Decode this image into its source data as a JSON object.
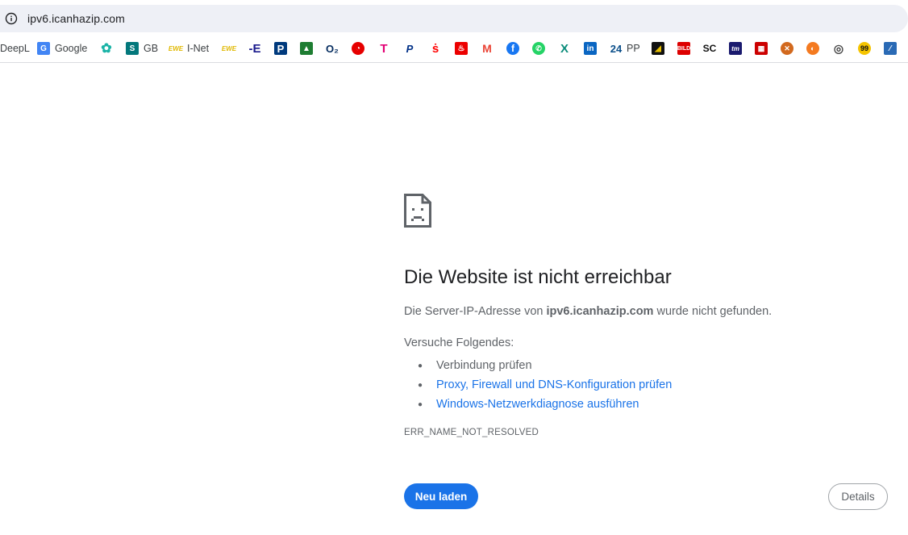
{
  "omnibox": {
    "url": "ipv6.icanhazip.com",
    "info_icon": "info-icon"
  },
  "bookmarks": [
    {
      "label": "DeepL",
      "icon": "deepl-icon",
      "color": "#0f2b46"
    },
    {
      "label": "Google",
      "icon": "google-translate-icon",
      "color": "#4285f4"
    },
    {
      "label": "",
      "icon": "flower-icon",
      "color": "#1ab3a6"
    },
    {
      "label": "GB",
      "icon": "sharepoint-icon",
      "color": "#03787c"
    },
    {
      "label": "I-Net",
      "icon": "ewe-icon",
      "color": "#f5d000"
    },
    {
      "label": "",
      "icon": "ewe-icon",
      "color": "#f5d000"
    },
    {
      "label": "",
      "icon": "e-icon",
      "color": "#1a1a8c"
    },
    {
      "label": "",
      "icon": "parking-icon",
      "color": "#003a7d"
    },
    {
      "label": "",
      "icon": "green-app-icon",
      "color": "#1e7d32"
    },
    {
      "label": "",
      "icon": "o2-icon",
      "color": "#032b5e"
    },
    {
      "label": "",
      "icon": "vodafone-icon",
      "color": "#e60000"
    },
    {
      "label": "",
      "icon": "telekom-icon",
      "color": "#e20074"
    },
    {
      "label": "",
      "icon": "paypal-icon",
      "color": "#003087"
    },
    {
      "label": "",
      "icon": "sparkasse-icon",
      "color": "#ff0000"
    },
    {
      "label": "",
      "icon": "santander-icon",
      "color": "#ec0000"
    },
    {
      "label": "",
      "icon": "gmail-icon",
      "color": "#ea4335"
    },
    {
      "label": "",
      "icon": "facebook-icon",
      "color": "#1877f2"
    },
    {
      "label": "",
      "icon": "whatsapp-icon",
      "color": "#25d366"
    },
    {
      "label": "",
      "icon": "xing-icon",
      "color": "#0a8c7a"
    },
    {
      "label": "",
      "icon": "linkedin-icon",
      "color": "#0a66c2"
    },
    {
      "label": "PP",
      "icon": "24-icon",
      "color": "#0b4f8a"
    },
    {
      "label": "",
      "icon": "yellow-app-icon",
      "color": "#e8c000"
    },
    {
      "label": "",
      "icon": "bild-icon",
      "color": "#dd0000"
    },
    {
      "label": "",
      "icon": "sc-icon",
      "color": "#111111"
    },
    {
      "label": "",
      "icon": "tm-icon",
      "color": "#1a1a6e"
    },
    {
      "label": "",
      "icon": "red-grid-icon",
      "color": "#cc0000"
    },
    {
      "label": "",
      "icon": "basketball-icon",
      "color": "#d2691e"
    },
    {
      "label": "",
      "icon": "orange-ball-icon",
      "color": "#f47a20"
    },
    {
      "label": "",
      "icon": "globe-icon",
      "color": "#444444"
    },
    {
      "label": "",
      "icon": "99-icon",
      "color": "#f5c400"
    },
    {
      "label": "",
      "icon": "blue-app-icon",
      "color": "#2a6ab5"
    }
  ],
  "error": {
    "title": "Die Website ist nicht erreichbar",
    "desc_prefix": "Die Server-IP-Adresse von ",
    "desc_host": "ipv6.icanhazip.com",
    "desc_suffix": " wurde nicht gefunden.",
    "suggest_heading": "Versuche Folgendes:",
    "suggestions": [
      {
        "text": "Verbindung prüfen",
        "link": false
      },
      {
        "text": "Proxy, Firewall und DNS-Konfiguration prüfen",
        "link": true
      },
      {
        "text": "Windows-Netzwerkdiagnose ausführen",
        "link": true
      }
    ],
    "code": "ERR_NAME_NOT_RESOLVED",
    "reload_label": "Neu laden",
    "details_label": "Details"
  },
  "colors": {
    "accent": "#1a73e8",
    "omnibox_bg": "#eef0f6",
    "secondary_text": "#5f6368"
  }
}
